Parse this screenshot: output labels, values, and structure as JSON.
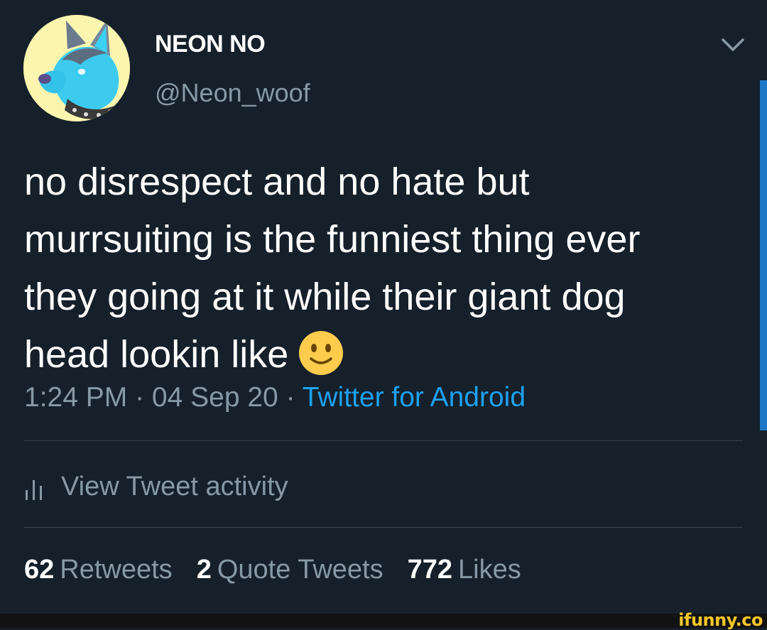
{
  "tweet": {
    "author": {
      "display_name": "NEON NO",
      "handle": "@Neon_woof"
    },
    "text_lines": [
      "no disrespect and no hate but",
      "murrsuiting is the funniest thing ever",
      "they going at it while their giant dog",
      "head lookin like"
    ],
    "emoji": "slightly-smiling-face-emoji",
    "meta": {
      "time": "1:24 PM",
      "separator": " · ",
      "date": "04 Sep 20",
      "source": "Twitter for Android"
    },
    "activity_label": "View Tweet activity",
    "stats": {
      "retweets_count": "62",
      "retweets_label": "Retweets",
      "quote_count": "2",
      "quote_label": "Quote Tweets",
      "likes_count": "772",
      "likes_label": "Likes"
    }
  },
  "icons": {
    "more": "chevron-down-icon",
    "activity": "bar-chart-icon"
  },
  "watermark": "ifunny.co",
  "colors": {
    "background": "#15202b",
    "text_primary": "#ffffff",
    "text_secondary": "#8899a6",
    "accent": "#1da1f2",
    "divider": "#38444d"
  }
}
